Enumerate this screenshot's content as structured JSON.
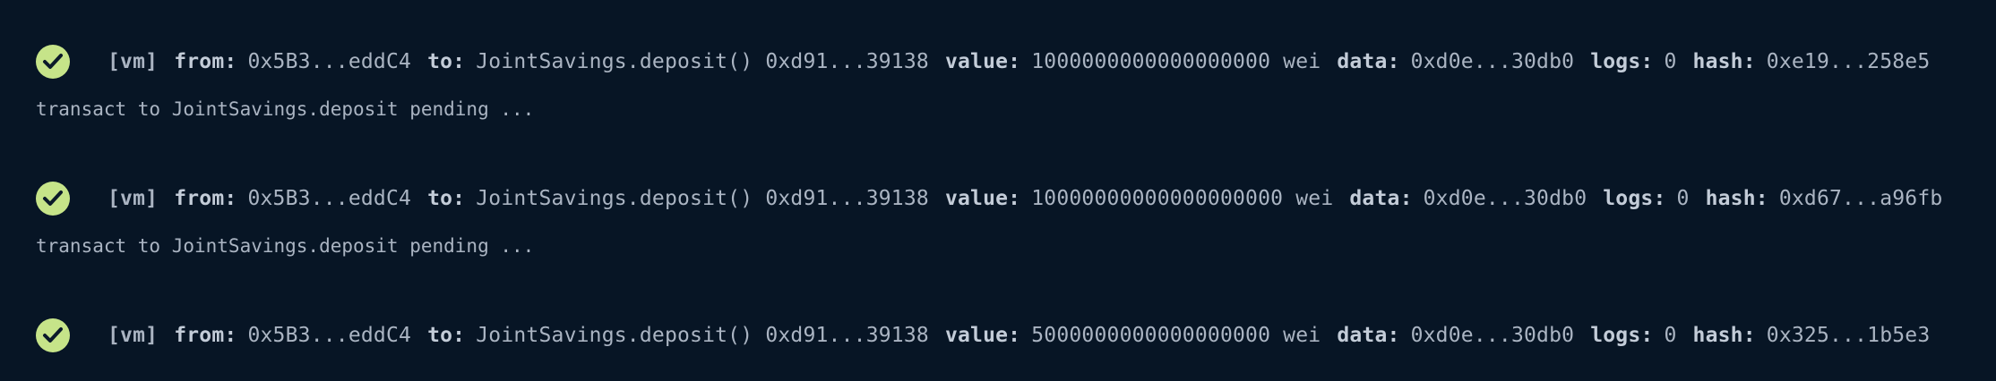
{
  "log": {
    "transactions": [
      {
        "vm": "[vm]",
        "from_label": "from:",
        "from": "0x5B3...eddC4",
        "to_label": "to:",
        "to": "JointSavings.deposit() 0xd91...39138",
        "value_label": "value:",
        "value": "1000000000000000000 wei",
        "data_label": "data:",
        "data": "0xd0e...30db0",
        "logs_label": "logs:",
        "logs": "0",
        "hash_label": "hash:",
        "hash": "0xe19...258e5"
      },
      {
        "vm": "[vm]",
        "from_label": "from:",
        "from": "0x5B3...eddC4",
        "to_label": "to:",
        "to": "JointSavings.deposit() 0xd91...39138",
        "value_label": "value:",
        "value": "10000000000000000000 wei",
        "data_label": "data:",
        "data": "0xd0e...30db0",
        "logs_label": "logs:",
        "logs": "0",
        "hash_label": "hash:",
        "hash": "0xd67...a96fb"
      },
      {
        "vm": "[vm]",
        "from_label": "from:",
        "from": "0x5B3...eddC4",
        "to_label": "to:",
        "to": "JointSavings.deposit() 0xd91...39138",
        "value_label": "value:",
        "value": "5000000000000000000 wei",
        "data_label": "data:",
        "data": "0xd0e...30db0",
        "logs_label": "logs:",
        "logs": "0",
        "hash_label": "hash:",
        "hash": "0x325...1b5e3"
      }
    ],
    "pending_lines": [
      "transact to JointSavings.deposit pending ...",
      "transact to JointSavings.deposit pending ..."
    ],
    "colors": {
      "background": "#071525",
      "check": "#c6e489",
      "text": "#aab4c2"
    },
    "icon": "check-circle-icon"
  }
}
